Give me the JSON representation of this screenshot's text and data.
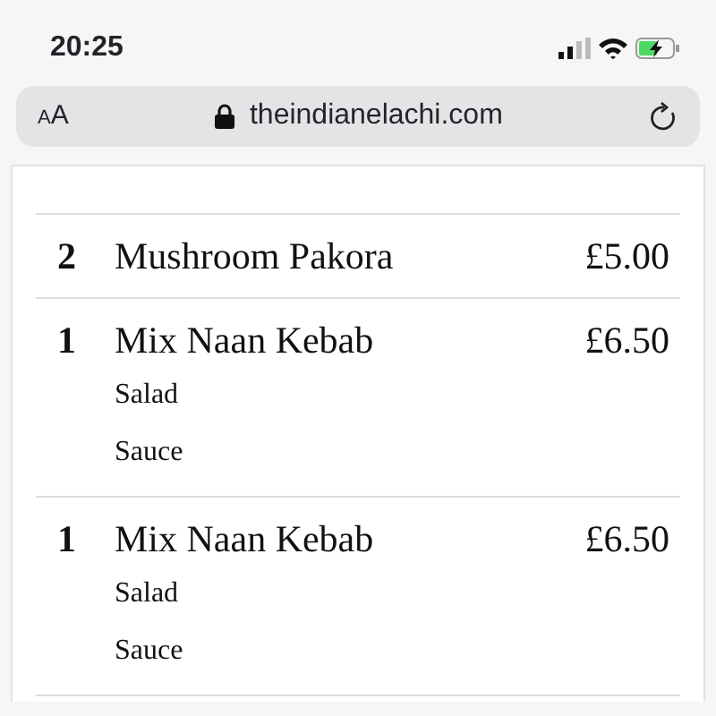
{
  "status_bar": {
    "time": "20:25"
  },
  "address_bar": {
    "text_size_label": "AA",
    "url": "theindianelachi.com"
  },
  "order_items": [
    {
      "quantity": "2",
      "name": "Mushroom Pakora",
      "price": "£5.00"
    },
    {
      "quantity": "1",
      "name": "Mix Naan Kebab",
      "price": "£6.50",
      "options": [
        "Salad",
        "Sauce"
      ]
    },
    {
      "quantity": "1",
      "name": "Mix Naan Kebab",
      "price": "£6.50",
      "options": [
        "Salad",
        "Sauce"
      ]
    }
  ]
}
